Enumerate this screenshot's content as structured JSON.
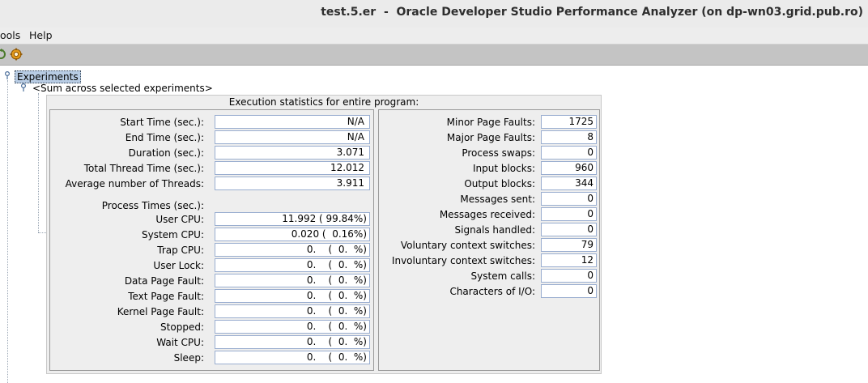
{
  "window": {
    "title": "test.5.er  -  Oracle Developer Studio Performance Analyzer (on dp-wn03.grid.pub.ro)"
  },
  "menu": {
    "tools": "ools",
    "help": "Help"
  },
  "toolbar": {
    "icons": [
      "refresh-icon",
      "settings-gear-icon"
    ]
  },
  "tree": {
    "root_label": "Experiments",
    "child_label": "<Sum across selected experiments>"
  },
  "stats": {
    "title": "Execution statistics for entire program:",
    "left": [
      {
        "label": "Start Time (sec.):",
        "value": "N/A"
      },
      {
        "label": "End Time (sec.):",
        "value": "N/A"
      },
      {
        "label": "Duration (sec.):",
        "value": "3.071"
      },
      {
        "label": "Total Thread Time (sec.):",
        "value": "12.012"
      },
      {
        "label": "Average number of Threads:",
        "value": "3.911"
      }
    ],
    "process_times_header": "Process Times (sec.):",
    "process": [
      {
        "label": "User CPU:",
        "value": "11.992 ( 99.84%)"
      },
      {
        "label": "System CPU:",
        "value": "0.020 (  0.16%)"
      },
      {
        "label": "Trap CPU:",
        "value": "0.    (  0.  %)"
      },
      {
        "label": "User Lock:",
        "value": "0.    (  0.  %)"
      },
      {
        "label": "Data Page Fault:",
        "value": "0.    (  0.  %)"
      },
      {
        "label": "Text Page Fault:",
        "value": "0.    (  0.  %)"
      },
      {
        "label": "Kernel Page Fault:",
        "value": "0.    (  0.  %)"
      },
      {
        "label": "Stopped:",
        "value": "0.    (  0.  %)"
      },
      {
        "label": "Wait CPU:",
        "value": "0.    (  0.  %)"
      },
      {
        "label": "Sleep:",
        "value": "0.    (  0.  %)"
      }
    ],
    "right": [
      {
        "label": "Minor Page Faults:",
        "value": "1725"
      },
      {
        "label": "Major Page Faults:",
        "value": "8"
      },
      {
        "label": "Process swaps:",
        "value": "0"
      },
      {
        "label": "Input blocks:",
        "value": "960"
      },
      {
        "label": "Output blocks:",
        "value": "344"
      },
      {
        "label": "Messages sent:",
        "value": "0"
      },
      {
        "label": "Messages received:",
        "value": "0"
      },
      {
        "label": "Signals handled:",
        "value": "0"
      },
      {
        "label": "Voluntary context switches:",
        "value": "79"
      },
      {
        "label": "Involuntary context switches:",
        "value": "12"
      },
      {
        "label": "System calls:",
        "value": "0"
      },
      {
        "label": "Characters of I/O:",
        "value": "0"
      }
    ]
  }
}
